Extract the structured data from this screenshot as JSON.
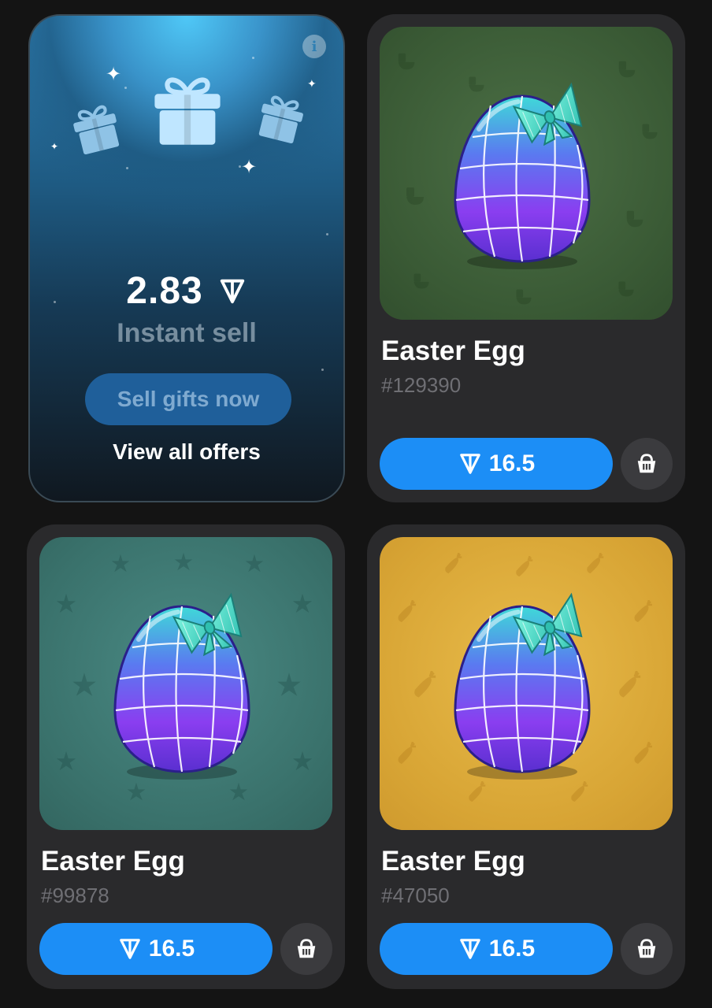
{
  "promo": {
    "price": "2.83",
    "currency_icon": "ton-icon",
    "subtitle": "Instant sell",
    "sell_button": "Sell gifts now",
    "offers_link": "View all offers",
    "info_icon": "info-icon"
  },
  "gifts": [
    {
      "name": "Easter Egg",
      "number": "#129390",
      "price": "16.5",
      "background": "#3e5f3a",
      "pattern_icon": "toilet-icon"
    },
    {
      "name": "Easter Egg",
      "number": "#99878",
      "price": "16.5",
      "background": "#3b7670",
      "pattern_icon": "lily-icon"
    },
    {
      "name": "Easter Egg",
      "number": "#47050",
      "price": "16.5",
      "background": "#dcaa38",
      "pattern_icon": "carrot-icon"
    }
  ],
  "colors": {
    "accent": "#1c8ef6",
    "card": "#2a2a2c",
    "page": "#141414"
  }
}
